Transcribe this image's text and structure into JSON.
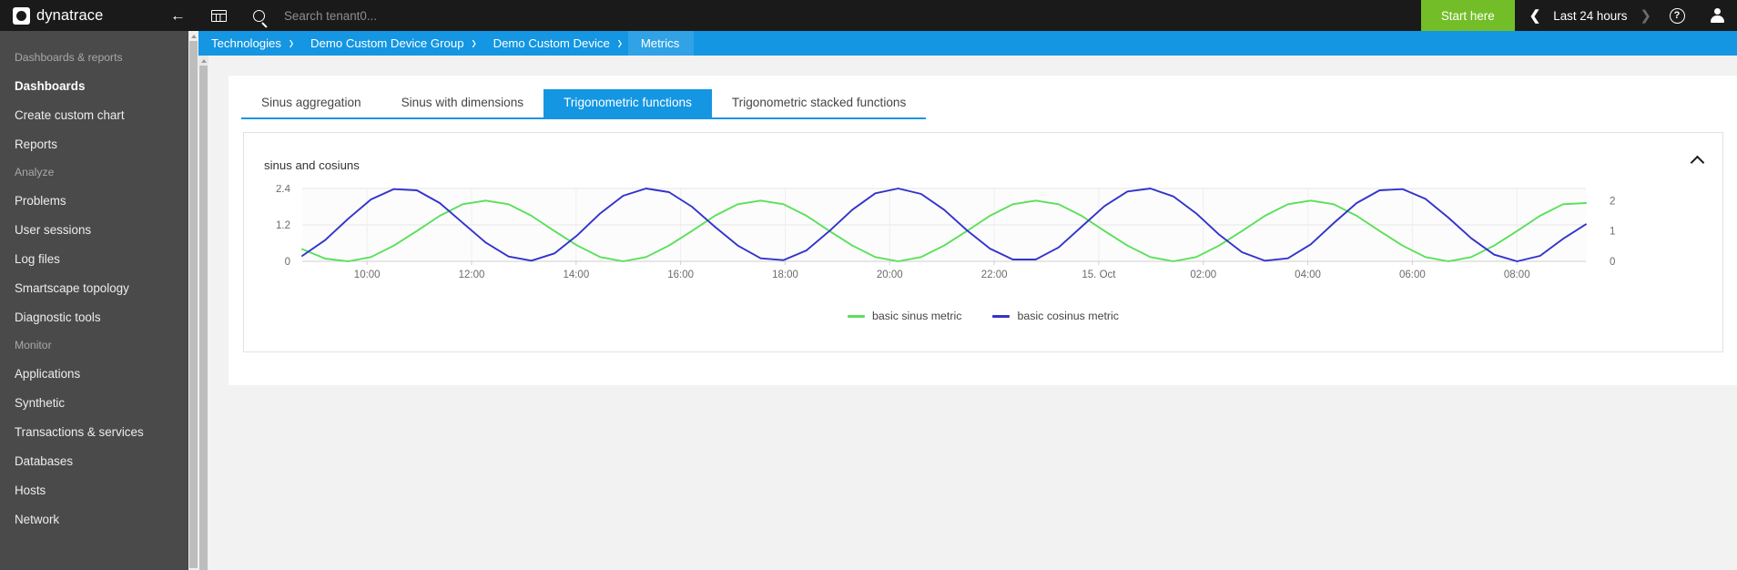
{
  "brand": {
    "name": "dynatrace",
    "logo_icon": "dynatrace-hexagon-logo",
    "collapse_icon": "arrow-left-icon"
  },
  "sidebar": {
    "groups": [
      {
        "label": "Dashboards & reports",
        "items": [
          {
            "label": "Dashboards",
            "bold": true
          },
          {
            "label": "Create custom chart",
            "bold": false
          },
          {
            "label": "Reports",
            "bold": false
          }
        ]
      },
      {
        "label": "Analyze",
        "items": [
          {
            "label": "Problems",
            "bold": false
          },
          {
            "label": "User sessions",
            "bold": false
          },
          {
            "label": "Log files",
            "bold": false
          },
          {
            "label": "Smartscape topology",
            "bold": false
          },
          {
            "label": "Diagnostic tools",
            "bold": false
          }
        ]
      },
      {
        "label": "Monitor",
        "items": [
          {
            "label": "Applications",
            "bold": false
          },
          {
            "label": "Synthetic",
            "bold": false
          },
          {
            "label": "Transactions & services",
            "bold": false
          },
          {
            "label": "Databases",
            "bold": false
          },
          {
            "label": "Hosts",
            "bold": false
          },
          {
            "label": "Network",
            "bold": false
          }
        ]
      }
    ]
  },
  "topbar": {
    "grid_icon": "dashboard-grid-icon",
    "search_icon": "search-icon",
    "search_placeholder": "Search tenant0...",
    "search_value": "",
    "start_here_label": "Start here",
    "prev_icon": "chevron-left-icon",
    "timerange_label": "Last 24 hours",
    "next_icon": "chevron-right-icon",
    "help_icon": "help-question-icon",
    "user_icon": "user-avatar-icon"
  },
  "breadcrumb": {
    "items": [
      {
        "label": "Technologies",
        "current": false
      },
      {
        "label": "Demo Custom Device Group",
        "current": false
      },
      {
        "label": "Demo Custom Device",
        "current": false
      },
      {
        "label": "Metrics",
        "current": true
      }
    ],
    "separator": "›"
  },
  "tabs": [
    {
      "label": "Sinus aggregation",
      "active": false
    },
    {
      "label": "Sinus with dimensions",
      "active": false
    },
    {
      "label": "Trigonometric functions",
      "active": true
    },
    {
      "label": "Trigonometric stacked functions",
      "active": false
    }
  ],
  "card": {
    "collapse_icon": "chevron-up-icon"
  },
  "colors": {
    "accent_blue": "#1496e2",
    "start_here_green": "#73be28",
    "sinus_green": "#5ae05a",
    "cosinus_blue": "#3333cc",
    "dark_header": "#1a1a1a",
    "sidebar_gray": "#4a4a4a"
  },
  "chart_data": {
    "type": "line",
    "title": "sinus and cosiuns",
    "xlabel": "",
    "ylabel": "",
    "grid": true,
    "legend_position": "bottom",
    "x_tick_labels": [
      "10:00",
      "12:00",
      "14:00",
      "16:00",
      "18:00",
      "20:00",
      "22:00",
      "15. Oct",
      "02:00",
      "04:00",
      "06:00",
      "08:00"
    ],
    "y_left_ticks": [
      "0",
      "1.2",
      "2.4"
    ],
    "y_left_lim": [
      0,
      2.4
    ],
    "y_right_ticks": [
      "0",
      "1",
      "2"
    ],
    "y_right_lim": [
      0,
      2.4
    ],
    "series": [
      {
        "name": "basic sinus metric",
        "color": "#5ae05a",
        "axis": "right",
        "amplitude": 1.0,
        "offset": 1.0,
        "period_hours": 4.8,
        "phase_hours": 1.45,
        "values": [
          0.4,
          0.09,
          0.0,
          0.14,
          0.52,
          1.0,
          1.5,
          1.88,
          2.0,
          1.88,
          1.5,
          1.0,
          0.52,
          0.14,
          0.0,
          0.14,
          0.52,
          1.0,
          1.5,
          1.88,
          2.0,
          1.88,
          1.5,
          1.0,
          0.52,
          0.14,
          0.0,
          0.14,
          0.52,
          1.0,
          1.5,
          1.88,
          2.0,
          1.88,
          1.5,
          1.0,
          0.52,
          0.14,
          0.0,
          0.14,
          0.52,
          1.0,
          1.5,
          1.88,
          2.0,
          1.88,
          1.5,
          1.0,
          0.52,
          0.14,
          0.0,
          0.14,
          0.52,
          1.0,
          1.5,
          1.88,
          1.92
        ]
      },
      {
        "name": "basic cosinus metric",
        "color": "#3333cc",
        "axis": "left",
        "amplitude": 1.2,
        "offset": 1.2,
        "period_hours": 4.8,
        "phase_hours": 0.0,
        "values": [
          0.18,
          0.7,
          1.4,
          2.04,
          2.38,
          2.34,
          1.92,
          1.27,
          0.62,
          0.16,
          0.02,
          0.26,
          0.86,
          1.58,
          2.16,
          2.4,
          2.28,
          1.8,
          1.14,
          0.52,
          0.1,
          0.04,
          0.36,
          1.0,
          1.7,
          2.24,
          2.4,
          2.22,
          1.7,
          1.02,
          0.42,
          0.06,
          0.06,
          0.46,
          1.14,
          1.82,
          2.3,
          2.4,
          2.14,
          1.58,
          0.88,
          0.3,
          0.02,
          0.1,
          0.56,
          1.26,
          1.92,
          2.34,
          2.38,
          2.06,
          1.44,
          0.76,
          0.22,
          0.0,
          0.18,
          0.74,
          1.22
        ]
      }
    ]
  }
}
